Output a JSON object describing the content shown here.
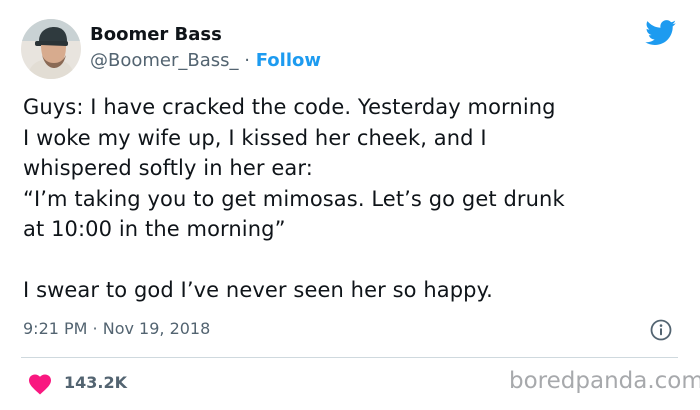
{
  "author": {
    "display_name": "Boomer Bass",
    "handle": "@Boomer_Bass_",
    "separator": "·",
    "follow_label": "Follow",
    "avatar_icon": "profile-photo"
  },
  "brand_icon": "twitter-bird-icon",
  "tweet": {
    "lines": [
      "Guys: I have cracked the code. Yesterday morning",
      "I woke my wife up, I kissed her cheek, and I",
      "whispered softly in her ear:",
      "“I’m taking you to get mimosas. Let’s go get drunk",
      "at 10:00 in the morning”",
      "I swear to god I’ve never seen her so happy."
    ]
  },
  "timestamp": "9:21 PM · Nov 19, 2018",
  "info_icon": "info-icon",
  "likes": {
    "count": "143.2K",
    "icon": "heart-icon"
  },
  "watermark": "boredpanda.com",
  "colors": {
    "accent": "#1d9bf0",
    "heart": "#f91880",
    "muted_text": "#536471",
    "divider": "#cfd9de",
    "watermark": "#a7a9ac"
  }
}
